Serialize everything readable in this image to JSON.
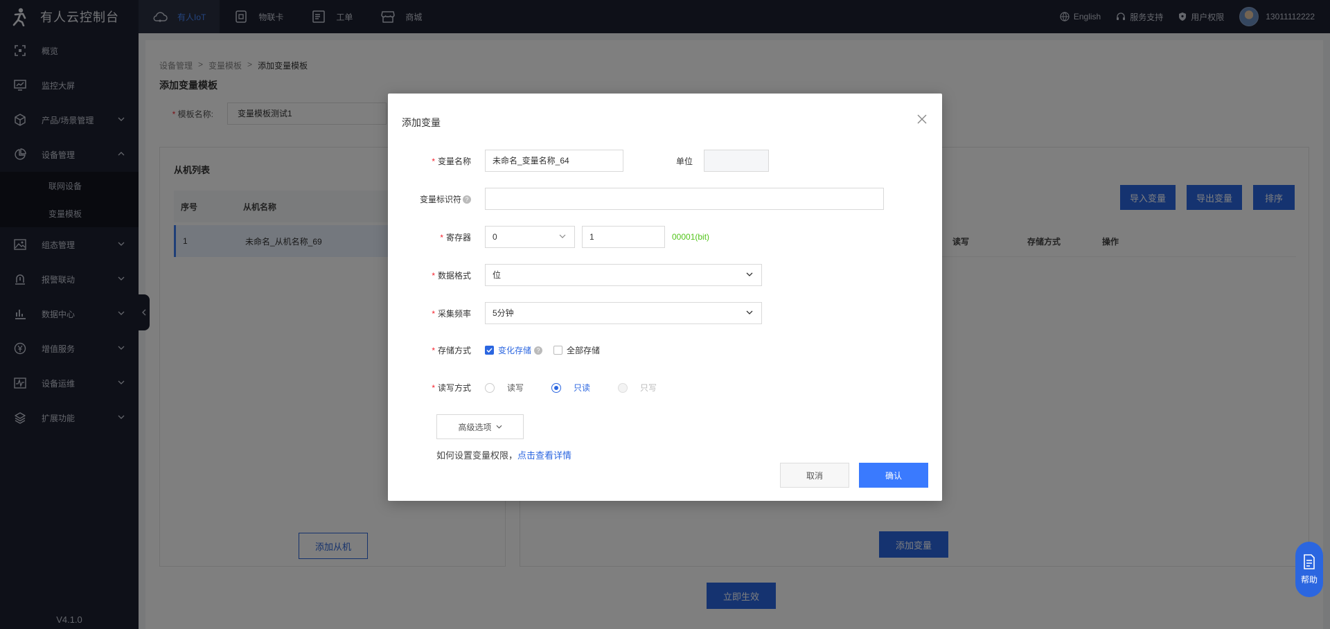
{
  "brand": {
    "title": "有人云控制台"
  },
  "top_nav": [
    {
      "label": "有人IoT",
      "icon": "cloud-icon",
      "active": true
    },
    {
      "label": "物联卡",
      "icon": "sim-card-icon",
      "active": false
    },
    {
      "label": "工单",
      "icon": "ticket-icon",
      "active": false
    },
    {
      "label": "商城",
      "icon": "shop-icon",
      "active": false
    }
  ],
  "top_right": {
    "language": "English",
    "support": "服务支持",
    "permission": "用户权限",
    "username": "13011112222"
  },
  "sidebar": {
    "items": [
      {
        "label": "概览",
        "icon": "overview-icon"
      },
      {
        "label": "监控大屏",
        "icon": "monitor-icon"
      },
      {
        "label": "产品/场景管理",
        "icon": "cube-icon"
      },
      {
        "label": "设备管理",
        "icon": "pie-icon"
      },
      {
        "label": "组态管理",
        "icon": "image-icon"
      },
      {
        "label": "报警联动",
        "icon": "alarm-icon"
      },
      {
        "label": "数据中心",
        "icon": "bar-chart-icon"
      },
      {
        "label": "增值服务",
        "icon": "yuan-icon"
      },
      {
        "label": "设备运维",
        "icon": "activity-icon"
      },
      {
        "label": "扩展功能",
        "icon": "layers-icon"
      }
    ],
    "sub_items": [
      "联网设备",
      "变量模板"
    ],
    "version": "V4.1.0"
  },
  "main": {
    "breadcrumb": [
      "设备管理",
      "变量模板",
      "添加变量模板"
    ],
    "page_title": "添加变量模板",
    "template_name_label": "模板名称:",
    "template_name_value": "变量模板测试1",
    "slave_list": {
      "title": "从机列表",
      "headers": [
        "序号",
        "从机名称"
      ],
      "rows": [
        {
          "no": "1",
          "name": "未命名_从机名称_69"
        }
      ],
      "add_button": "添加从机"
    },
    "variables": {
      "import_button": "导入变量",
      "export_button": "导出变量",
      "sort_button": "排序",
      "headers": [
        "读写",
        "存储方式",
        "操作"
      ],
      "add_button": "添加变量"
    },
    "apply_button": "立即生效"
  },
  "modal": {
    "title": "添加变量",
    "fields": {
      "var_name_label": "变量名称",
      "var_name_value": "未命名_变量名称_64",
      "unit_label": "单位",
      "unit_value": "",
      "identifier_label": "变量标识符",
      "identifier_value": "",
      "register_label": "寄存器",
      "register_type": "0",
      "register_addr": "1",
      "register_hint": "00001(bit)",
      "data_format_label": "数据格式",
      "data_format_value": "位",
      "freq_label": "采集频率",
      "freq_value": "5分钟",
      "storage_label": "存储方式",
      "storage_change": "变化存储",
      "storage_all": "全部存储",
      "rw_label": "读写方式",
      "rw_readwrite": "读写",
      "rw_readonly": "只读",
      "rw_writeonly": "只写"
    },
    "advanced_button": "高级选项",
    "hint_text": "如何设置变量权限，",
    "hint_link": "点击查看详情",
    "cancel_button": "取消",
    "confirm_button": "确认"
  },
  "help_fab": {
    "label": "帮助"
  },
  "colors": {
    "primary": "#2b66e0",
    "success": "#52c41a",
    "required": "#f5222d",
    "topbar": "#1c2031"
  }
}
